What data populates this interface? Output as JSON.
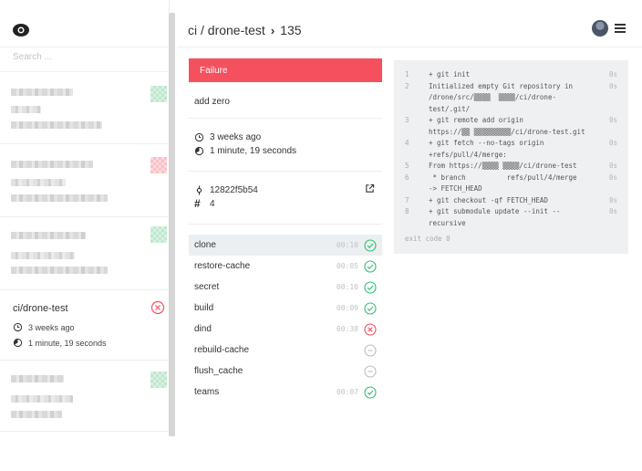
{
  "search": {
    "placeholder": "Search ..."
  },
  "header": {
    "repo": "ci / drone-test",
    "build_number": "135"
  },
  "sidebar": {
    "active_repo": {
      "name": "ci/drone-test",
      "time": "3 weeks ago",
      "duration": "1 minute, 19 seconds",
      "status": "failure"
    }
  },
  "build": {
    "status_label": "Failure",
    "message": "add zero",
    "time": "3 weeks ago",
    "duration": "1 minute, 19 seconds",
    "commit": "12822f5b54",
    "pr_number": "4"
  },
  "steps": [
    {
      "name": "clone",
      "duration": "00:10",
      "status": "success"
    },
    {
      "name": "restore-cache",
      "duration": "00:05",
      "status": "success"
    },
    {
      "name": "secret",
      "duration": "00:10",
      "status": "success"
    },
    {
      "name": "build",
      "duration": "00:09",
      "status": "success"
    },
    {
      "name": "dind",
      "duration": "00:38",
      "status": "failure"
    },
    {
      "name": "rebuild-cache",
      "duration": "",
      "status": "skipped"
    },
    {
      "name": "flush_cache",
      "duration": "",
      "status": "skipped"
    },
    {
      "name": "teams",
      "duration": "00:07",
      "status": "success"
    }
  ],
  "log": {
    "lines": [
      {
        "num": "1",
        "text": "+ git init",
        "time": "0s"
      },
      {
        "num": "2",
        "text": "Initialized empty Git repository in\n/drone/src/▒▒▒▒  ▒▒▒▒/ci/drone-\ntest/.git/",
        "time": "0s"
      },
      {
        "num": "3",
        "text": "+ git remote add origin\nhttps://▒▒ ▒▒▒▒▒▒▒▒▒/ci/drone-test.git",
        "time": "0s"
      },
      {
        "num": "4",
        "text": "+ git fetch --no-tags origin\n+refs/pull/4/merge:",
        "time": "0s"
      },
      {
        "num": "5",
        "text": "From https://▒▒▒▒ ▒▒▒▒/ci/drone-test",
        "time": "0s"
      },
      {
        "num": "6",
        "text": " * branch          refs/pull/4/merge\n-> FETCH_HEAD",
        "time": "0s"
      },
      {
        "num": "7",
        "text": "+ git checkout -qf FETCH_HEAD",
        "time": "0s"
      },
      {
        "num": "8",
        "text": "+ git submodule update --init --\nrecursive",
        "time": "0s"
      }
    ],
    "exit_code": "exit code 0"
  },
  "colors": {
    "failure": "#f4505e",
    "success": "#2fbf71",
    "skipped": "#bdbdbd"
  }
}
